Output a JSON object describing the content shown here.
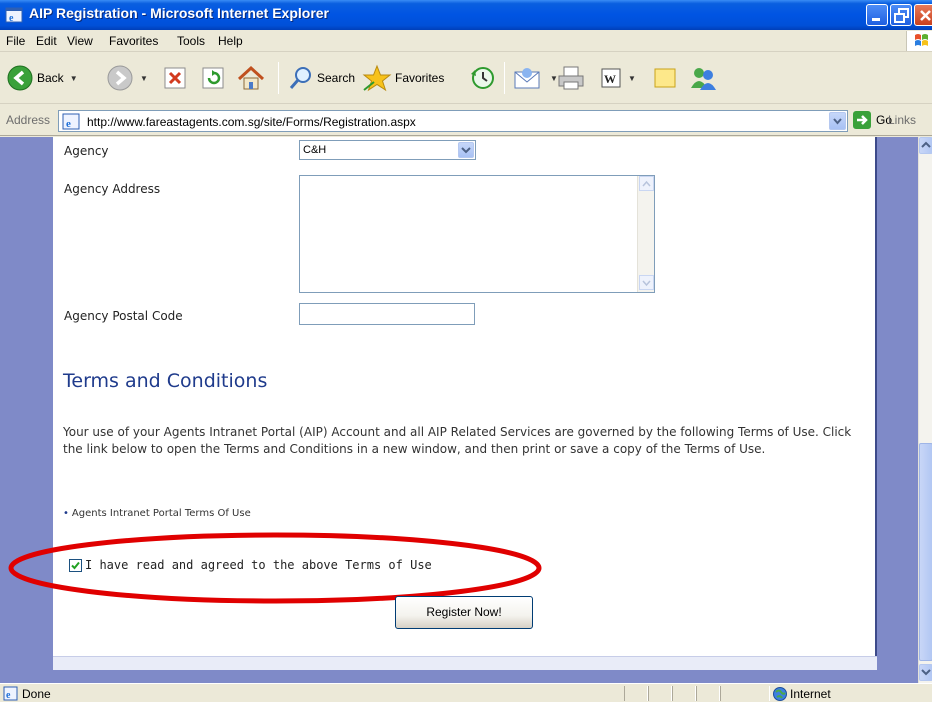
{
  "window": {
    "title": "AIP Registration - Microsoft Internet Explorer"
  },
  "menu": [
    "File",
    "Edit",
    "View",
    "Favorites",
    "Tools",
    "Help"
  ],
  "toolbar": {
    "back_label": "Back",
    "search_label": "Search",
    "favorites_label": "Favorites"
  },
  "address": {
    "label": "Address",
    "url": "http://www.fareastagents.com.sg/site/Forms/Registration.aspx",
    "go_label": "Go",
    "links_label": "Links"
  },
  "form": {
    "agency_label": "Agency",
    "agency_value": "C&H",
    "agency_address_label": "Agency Address",
    "postal_code_label": "Agency Postal Code"
  },
  "terms": {
    "heading": "Terms and Conditions",
    "body": "Your use of your Agents Intranet Portal (AIP) Account and all AIP Related Services are governed by the following Terms of Use. Click the link below to open the Terms and Conditions in a new window, and then print or save a copy of the Terms of Use.",
    "link_text": "Agents Intranet Portal Terms Of Use",
    "agree_label": "I have read and agreed to the above Terms of Use",
    "agree_checked": true,
    "register_label": "Register Now!"
  },
  "status": {
    "text": "Done",
    "zone": "Internet"
  },
  "colors": {
    "titlebar": "#0054e3",
    "heading": "#1f3b8c",
    "page_background": "#7f8ac8",
    "highlight_ellipse": "#e00000"
  }
}
